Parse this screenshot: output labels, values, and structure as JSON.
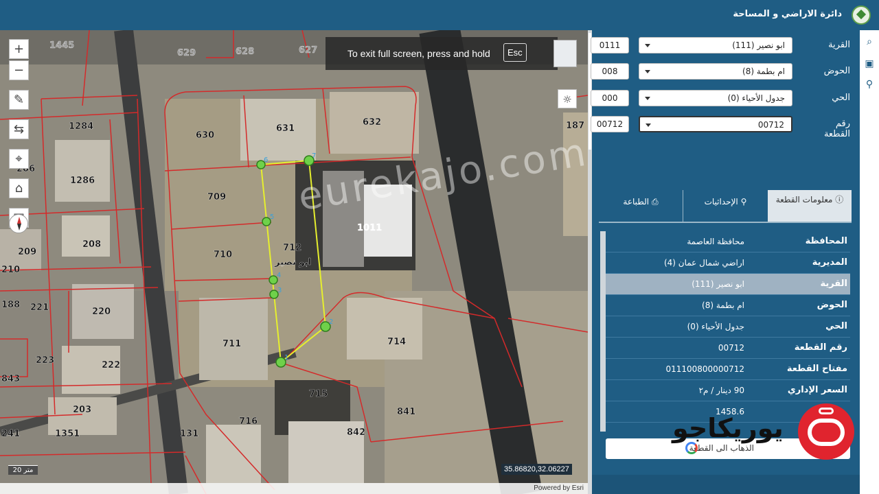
{
  "header": {
    "title": "دائرة الاراضي و المساحة",
    "logo_icon": "dls-logo-icon"
  },
  "map": {
    "fullscreen_msg": "To exit full screen, press and hold",
    "fullscreen_key": "Esc",
    "scale_label": "20 متر",
    "coordinates": "35.86820,32.06227",
    "attribution": "Powered by Esri",
    "watermark": "eurekajo.com",
    "parcel_labels": [
      "1445",
      "629",
      "628",
      "627",
      "1284",
      "630",
      "631",
      "632",
      "187",
      "1286",
      "709",
      "1011",
      "206",
      "208",
      "712",
      "ابو نصير",
      "710",
      "209",
      "210",
      "188",
      "221",
      "220",
      "711",
      "714",
      "223",
      "222",
      "843",
      "715",
      "203",
      "716",
      "841",
      "842",
      "241",
      "1351",
      "131"
    ],
    "vertex_labels": [
      "6",
      "7",
      "5",
      "4",
      "3",
      "2",
      "1"
    ]
  },
  "filters": [
    {
      "label": "القرية",
      "value": "ابو نصير (111)",
      "code": "0111"
    },
    {
      "label": "الحوض",
      "value": "ام بطمة (8)",
      "code": "008"
    },
    {
      "label": "الحي",
      "value": "جدول الأحياء (0)",
      "code": "000"
    },
    {
      "label": "رقم القطعة",
      "value": "00712",
      "code": "00712"
    }
  ],
  "tabs": {
    "info": "معلومات القطعة",
    "coords": "الإحداثيات",
    "print": "الطباعة"
  },
  "parcel_info": [
    {
      "key": "المحافظة",
      "value": "محافظة العاصمة"
    },
    {
      "key": "المديرية",
      "value": "اراضي شمال عمان (4)"
    },
    {
      "key": "القرية",
      "value": "ابو نصير (111)"
    },
    {
      "key": "الحوض",
      "value": "ام بطمة (8)"
    },
    {
      "key": "الحي",
      "value": "جدول الأحياء (0)"
    },
    {
      "key": "رقم القطعة",
      "value": "00712"
    },
    {
      "key": "مفتاح القطعة",
      "value": "011100800000712"
    },
    {
      "key": "السعر الإداري",
      "value": "90 دينار / م٢"
    },
    {
      "key": "",
      "value": "1458.6"
    }
  ],
  "goto_button": "الذهاب الى القطعة",
  "brand": {
    "name": "يوريكاجو"
  }
}
